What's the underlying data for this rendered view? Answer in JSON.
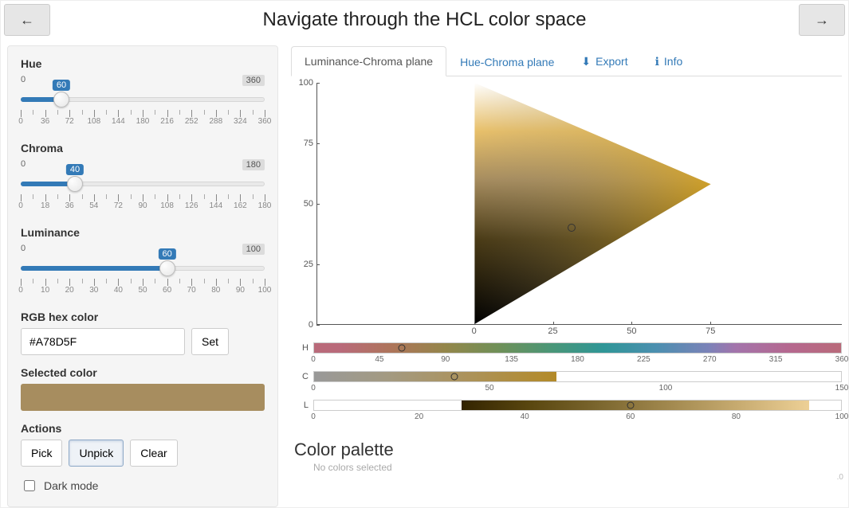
{
  "header": {
    "title": "Navigate through the HCL color space"
  },
  "sidebar": {
    "hue": {
      "label": "Hue",
      "min": "0",
      "max": "360",
      "value": 60,
      "pct": 16.67,
      "ticks": [
        0,
        36,
        72,
        108,
        144,
        180,
        216,
        252,
        288,
        324,
        360
      ]
    },
    "chroma": {
      "label": "Chroma",
      "min": "0",
      "max": "180",
      "value": 40,
      "pct": 22.22,
      "ticks": [
        0,
        18,
        36,
        54,
        72,
        90,
        108,
        126,
        144,
        162,
        180
      ]
    },
    "luminance": {
      "label": "Luminance",
      "min": "0",
      "max": "100",
      "value": 60,
      "pct": 60.0,
      "ticks": [
        0,
        10,
        20,
        30,
        40,
        50,
        60,
        70,
        80,
        90,
        100
      ]
    },
    "hex_label": "RGB hex color",
    "hex_value": "#A78D5F",
    "set_label": "Set",
    "selected_label": "Selected color",
    "selected_swatch": "#A78D5F",
    "actions_label": "Actions",
    "pick_label": "Pick",
    "unpick_label": "Unpick",
    "clear_label": "Clear",
    "darkmode_label": "Dark mode"
  },
  "tabs": {
    "lc": "Luminance-Chroma plane",
    "hc": "Hue-Chroma plane",
    "export": "Export",
    "info": "Info"
  },
  "plot": {
    "y_ticks": [
      "0",
      "25",
      "50",
      "75",
      "100"
    ],
    "x_ticks": [
      "0",
      "25",
      "50",
      "75"
    ],
    "marker": {
      "x_pct": 30.8,
      "y_pct": 40.0
    }
  },
  "strips": {
    "h": {
      "label": "H",
      "marker_pct": 16.67,
      "axis": [
        "0",
        "45",
        "90",
        "135",
        "180",
        "225",
        "270",
        "315",
        "360"
      ]
    },
    "c": {
      "label": "C",
      "marker_pct": 26.67,
      "axis": [
        "0",
        "50",
        "100",
        "150"
      ]
    },
    "l": {
      "label": "L",
      "marker_pct": 60.0,
      "axis": [
        "0",
        "20",
        "40",
        "60",
        "80",
        "100"
      ]
    }
  },
  "palette": {
    "heading": "Color palette",
    "empty": "No colors selected"
  },
  "origin_marker": ".0"
}
